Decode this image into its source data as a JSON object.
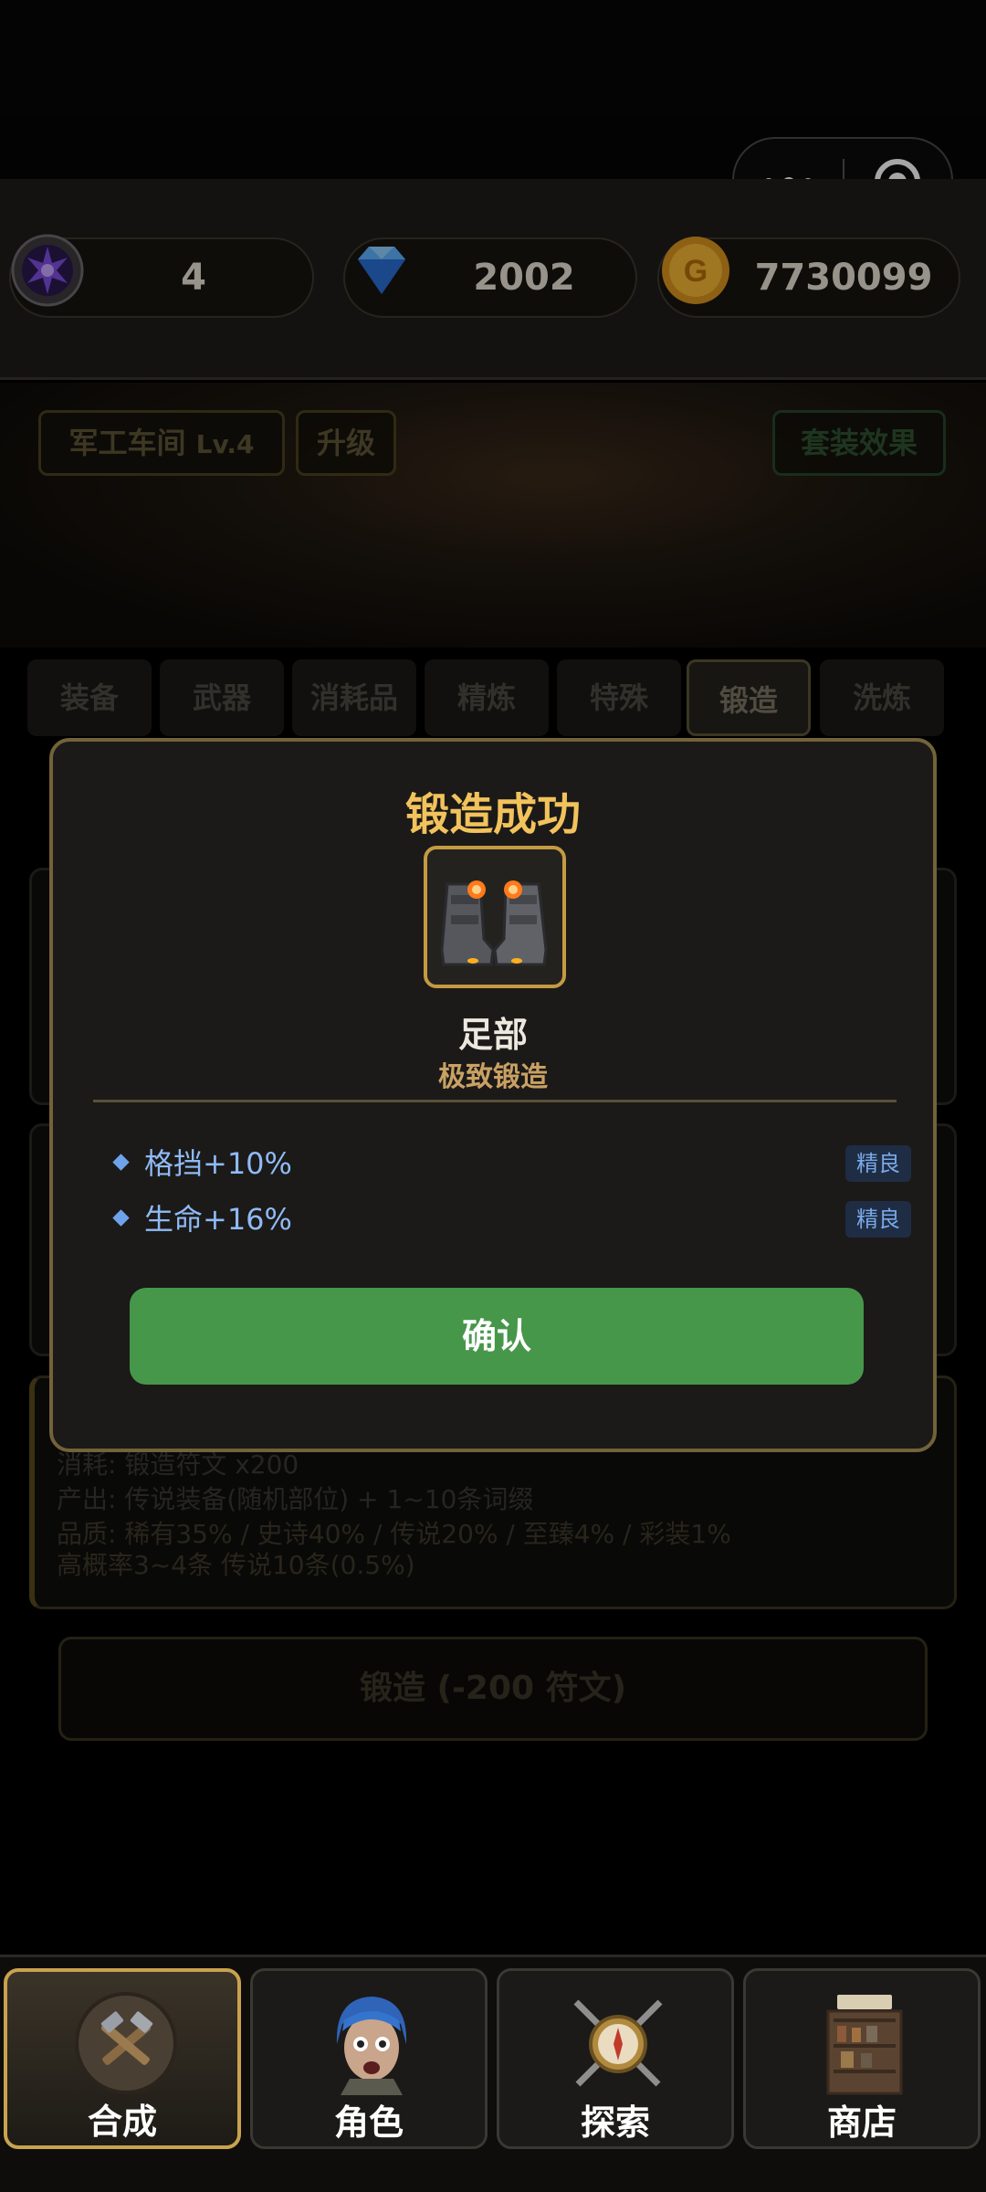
{
  "currencies": {
    "rune_count": "4",
    "diamonds": "2002",
    "gold": "7730099",
    "colors": {
      "rune": "#6b3fb8",
      "diamond": "#4fa8ff",
      "gold": "#f2b233"
    }
  },
  "workshop": {
    "title": "军工车间",
    "level": "Lv.4",
    "upgrade_label": "升级",
    "set_effect_label": "套装效果"
  },
  "tabs": [
    {
      "label": "装备"
    },
    {
      "label": "武器"
    },
    {
      "label": "消耗品"
    },
    {
      "label": "精炼"
    },
    {
      "label": "特殊"
    },
    {
      "label": "锻造",
      "active": true
    },
    {
      "label": "洗炼"
    }
  ],
  "background": {
    "forge_cost_line": "消耗: 锻造符文 x200",
    "forge_output_line": "产出: 传说装备(随机部位) + 1~10条词缀",
    "forge_quality_line": "品质: 稀有35% / 史诗40% / 传说20% / 至臻4% / 彩装1%",
    "forge_chance_line": "高概率3~4条  传说10条(0.5%)",
    "forge_button_label": "锻造 (-200 符文)"
  },
  "modal": {
    "title": "锻造成功",
    "item_icon": "armored-boots-icon",
    "item_name": "足部",
    "item_subtitle": "极致锻造",
    "affixes": [
      {
        "text": "格挡+10%",
        "badge": "精良"
      },
      {
        "text": "生命+16%",
        "badge": "精良"
      }
    ],
    "confirm_label": "确认",
    "accent_color": "#f2c25c",
    "confirm_color": "#47974b"
  },
  "bottom_nav": [
    {
      "label": "合成",
      "icon": "crafting-tools-icon",
      "active": true
    },
    {
      "label": "角色",
      "icon": "character-portrait-icon"
    },
    {
      "label": "探索",
      "icon": "compass-swords-icon"
    },
    {
      "label": "商店",
      "icon": "shop-shelf-icon"
    }
  ]
}
